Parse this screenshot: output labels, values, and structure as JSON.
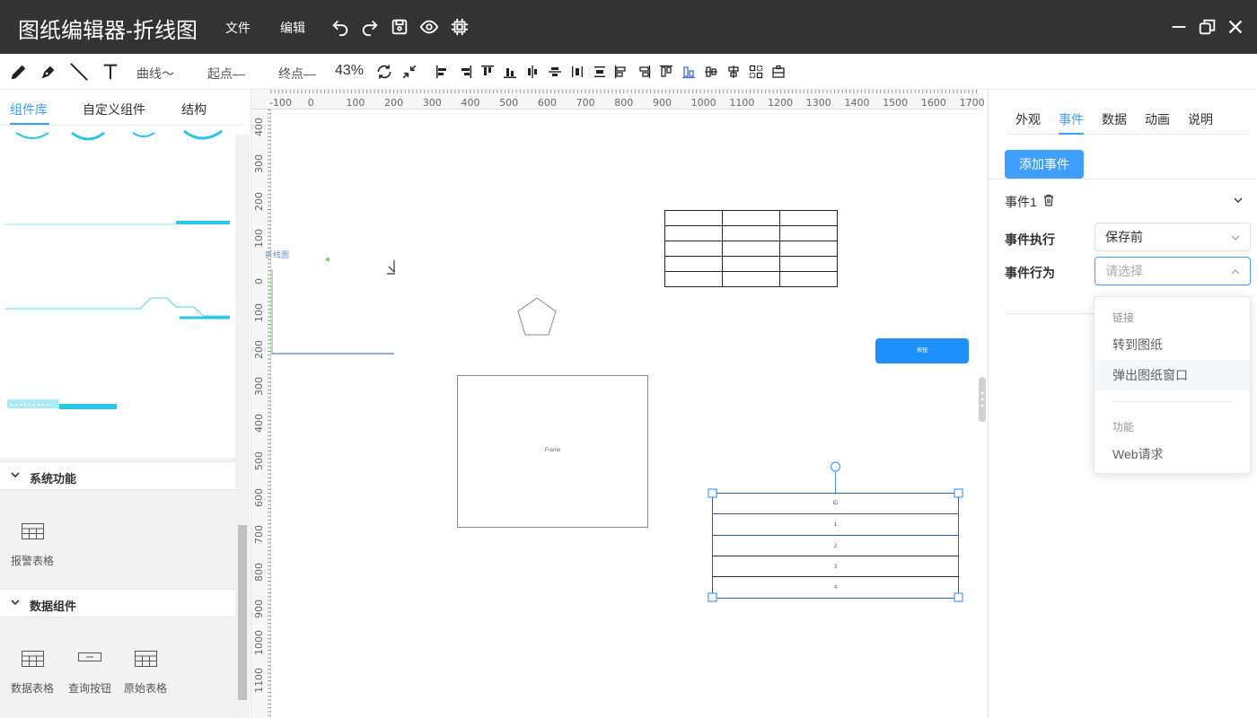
{
  "app": {
    "title": "图纸编辑器-折线图",
    "menu": [
      "文件",
      "编辑"
    ]
  },
  "toolbar": {
    "curve_label": "曲线～",
    "start_label": "起点—",
    "end_label": "终点—",
    "zoom": "43%"
  },
  "left_panel": {
    "tabs": [
      "组件库",
      "自定义组件",
      "结构"
    ],
    "active_tab": "组件库",
    "sections": [
      {
        "title": "系统功能",
        "items": [
          "报警表格"
        ]
      },
      {
        "title": "数据组件",
        "items": [
          "数据表格",
          "查询按钮",
          "原始表格"
        ]
      }
    ]
  },
  "canvas": {
    "ruler_top": [
      "-100",
      "0",
      "100",
      "200",
      "300",
      "400",
      "500",
      "600",
      "700",
      "800",
      "900",
      "1000",
      "1100",
      "1200",
      "1300",
      "1400",
      "1500",
      "1600",
      "1700"
    ],
    "ruler_left": [
      "400",
      "300",
      "200",
      "100",
      "0",
      "100",
      "200",
      "300",
      "400",
      "500",
      "600",
      "700",
      "800",
      "900",
      "1000",
      "1100"
    ],
    "chart_label": "折线图",
    "button_label": "按钮",
    "frame_label": "Frame",
    "table_rows": [
      "ID",
      "1",
      "2",
      "3",
      "4"
    ]
  },
  "right_panel": {
    "tabs": [
      "外观",
      "事件",
      "数据",
      "动画",
      "说明"
    ],
    "active_tab": "事件",
    "add_event_button": "添加事件",
    "event_title": "事件1",
    "exec_label": "事件执行",
    "exec_value": "保存前",
    "action_label": "事件行为",
    "action_placeholder": "请选择",
    "dropdown": {
      "group1": "链接",
      "items1": [
        "转到图纸",
        "弹出图纸窗口"
      ],
      "group2": "功能",
      "items2": [
        "Web请求"
      ]
    }
  }
}
